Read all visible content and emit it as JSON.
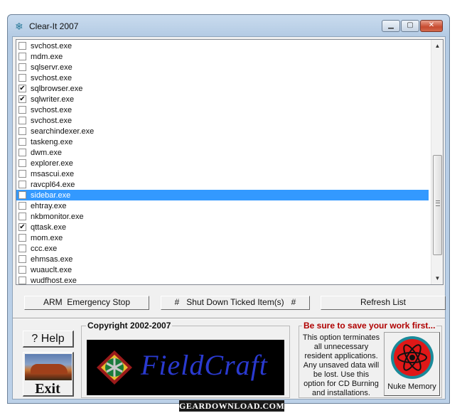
{
  "window": {
    "title": "Clear-It 2007",
    "icon": "snowflake-icon",
    "controls": {
      "minimize": "minimize-icon",
      "maximize": "maximize-icon",
      "close": "close-icon"
    }
  },
  "process_list": {
    "items": [
      {
        "label": "svchost.exe",
        "checked": false,
        "selected": false
      },
      {
        "label": "mdm.exe",
        "checked": false,
        "selected": false
      },
      {
        "label": "sqlservr.exe",
        "checked": false,
        "selected": false
      },
      {
        "label": "svchost.exe",
        "checked": false,
        "selected": false
      },
      {
        "label": "sqlbrowser.exe",
        "checked": true,
        "selected": false
      },
      {
        "label": "sqlwriter.exe",
        "checked": true,
        "selected": false
      },
      {
        "label": "svchost.exe",
        "checked": false,
        "selected": false
      },
      {
        "label": "svchost.exe",
        "checked": false,
        "selected": false
      },
      {
        "label": "searchindexer.exe",
        "checked": false,
        "selected": false
      },
      {
        "label": "taskeng.exe",
        "checked": false,
        "selected": false
      },
      {
        "label": "dwm.exe",
        "checked": false,
        "selected": false
      },
      {
        "label": "explorer.exe",
        "checked": false,
        "selected": false
      },
      {
        "label": "msascui.exe",
        "checked": false,
        "selected": false
      },
      {
        "label": "ravcpl64.exe",
        "checked": false,
        "selected": false
      },
      {
        "label": "sidebar.exe",
        "checked": false,
        "selected": true
      },
      {
        "label": "ehtray.exe",
        "checked": false,
        "selected": false
      },
      {
        "label": "nkbmonitor.exe",
        "checked": false,
        "selected": false
      },
      {
        "label": "qttask.exe",
        "checked": true,
        "selected": false
      },
      {
        "label": "mom.exe",
        "checked": false,
        "selected": false
      },
      {
        "label": "ccc.exe",
        "checked": false,
        "selected": false
      },
      {
        "label": "ehmsas.exe",
        "checked": false,
        "selected": false
      },
      {
        "label": "wuauclt.exe",
        "checked": false,
        "selected": false
      },
      {
        "label": "wudfhost.exe",
        "checked": false,
        "selected": false
      }
    ]
  },
  "actions": {
    "arm_label": "ARM  Emergency Stop",
    "shutdown_label": "#   Shut Down Ticked Item(s)   #",
    "refresh_label": "Refresh List"
  },
  "help": {
    "label": "? Help"
  },
  "exit": {
    "label": "Exit"
  },
  "copyright": {
    "label": "Copyright 2002-2007",
    "logo_text": "FieldCraft"
  },
  "warning": {
    "title": "Be sure to save your work first...",
    "text": "This option terminates all unnecessary resident applications. Any unsaved data will be lost. Use this option for CD Burning and installations.",
    "nuke_label": "Nuke Memory"
  },
  "watermark": {
    "text": "GEARDOWNLOAD.COM"
  },
  "colors": {
    "selection": "#3399ff",
    "warning_title": "#b00000",
    "logo_text": "#2a3ad0",
    "nuke_icon": "#e01818"
  }
}
